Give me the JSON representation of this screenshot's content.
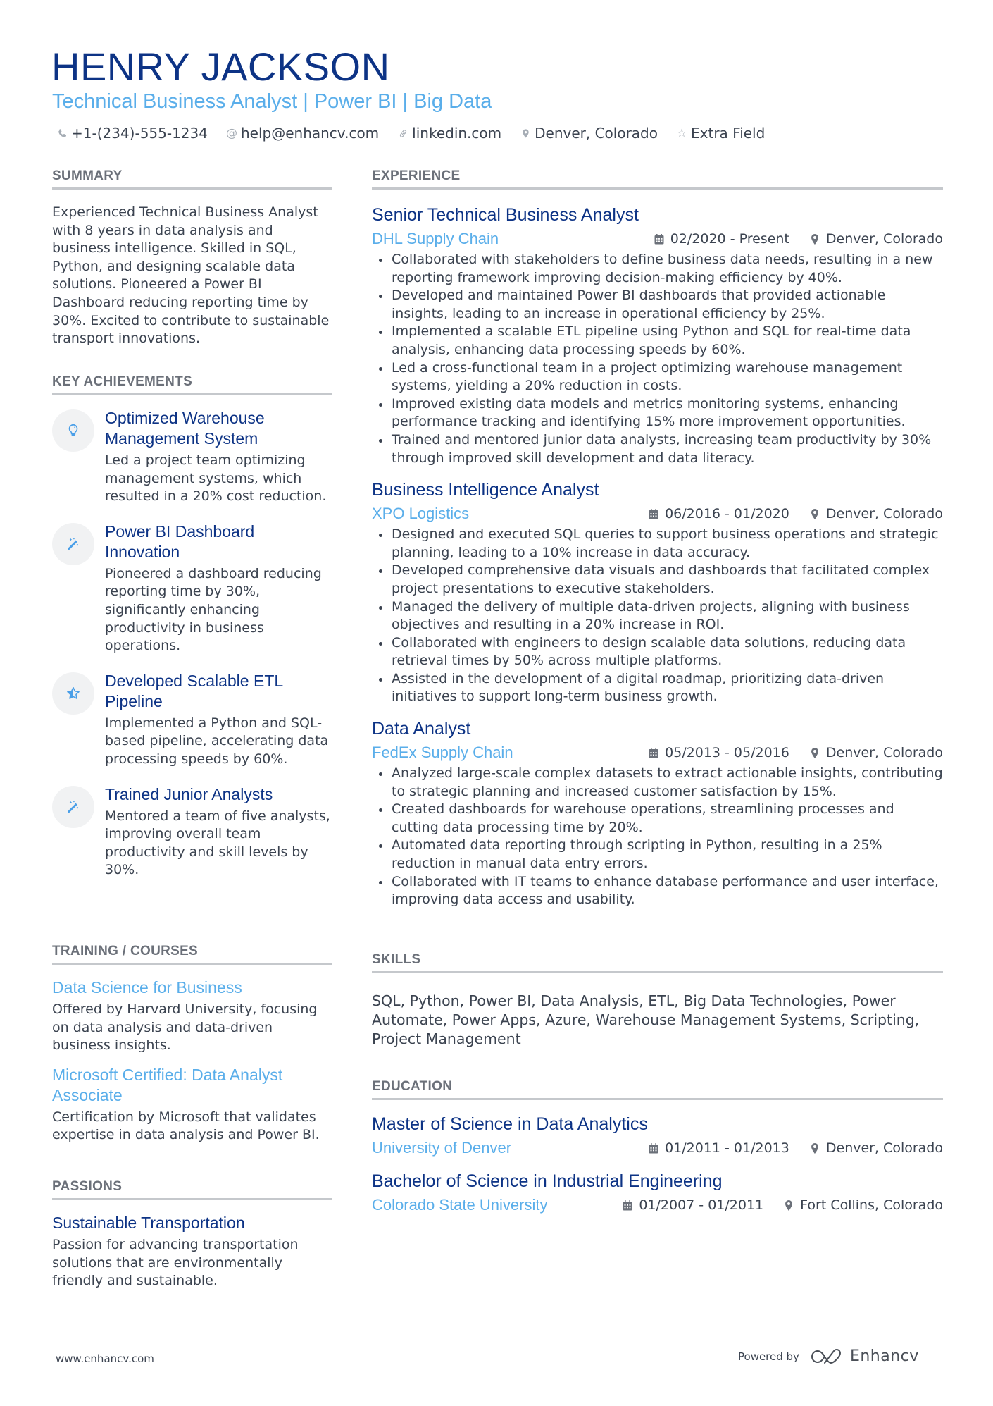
{
  "header": {
    "name": "HENRY JACKSON",
    "headline": "Technical Business Analyst | Power BI | Big Data",
    "contacts": [
      {
        "icon": "phone-icon",
        "text": "+1-(234)-555-1234"
      },
      {
        "icon": "at-icon",
        "text": "help@enhancv.com"
      },
      {
        "icon": "link-icon",
        "text": "linkedin.com"
      },
      {
        "icon": "location-pin-icon",
        "text": "Denver, Colorado"
      },
      {
        "icon": "star-outline-icon",
        "text": "Extra Field"
      }
    ]
  },
  "summary": {
    "title": "SUMMARY",
    "text": "Experienced Technical Business Analyst with 8 years in data analysis and business intelligence. Skilled in SQL, Python, and designing scalable data solutions. Pioneered a Power BI Dashboard reducing reporting time by 30%. Excited to contribute to sustainable transport innovations."
  },
  "achievements": {
    "title": "KEY ACHIEVEMENTS",
    "items": [
      {
        "icon": "lightbulb-icon",
        "title": "Optimized Warehouse Management System",
        "description": "Led a project team optimizing management systems, which resulted in a 20% cost reduction."
      },
      {
        "icon": "magic-wand-icon",
        "title": "Power BI Dashboard Innovation",
        "description": "Pioneered a dashboard reducing reporting time by 30%, significantly enhancing productivity in business operations."
      },
      {
        "icon": "star-half-icon",
        "title": "Developed Scalable ETL Pipeline",
        "description": "Implemented a Python and SQL-based pipeline, accelerating data processing speeds by 60%."
      },
      {
        "icon": "magic-wand-icon",
        "title": "Trained Junior Analysts",
        "description": "Mentored a team of five analysts, improving overall team productivity and skill levels by 30%."
      }
    ]
  },
  "training": {
    "title": "TRAINING / COURSES",
    "items": [
      {
        "title": "Data Science for Business",
        "description": "Offered by Harvard University, focusing on data analysis and data-driven business insights."
      },
      {
        "title": "Microsoft Certified: Data Analyst Associate",
        "description": "Certification by Microsoft that validates expertise in data analysis and Power BI."
      }
    ]
  },
  "passions": {
    "title": "PASSIONS",
    "items": [
      {
        "title": "Sustainable Transportation",
        "description": "Passion for advancing transportation solutions that are environmentally friendly and sustainable."
      }
    ]
  },
  "experience": {
    "title": "EXPERIENCE",
    "jobs": [
      {
        "title": "Senior Technical Business Analyst",
        "company": "DHL Supply Chain",
        "dates": "02/2020 - Present",
        "location": "Denver, Colorado",
        "bullets": [
          "Collaborated with stakeholders to define business data needs, resulting in a new reporting framework improving decision-making efficiency by 40%.",
          "Developed and maintained Power BI dashboards that provided actionable insights, leading to an increase in operational efficiency by 25%.",
          "Implemented a scalable ETL pipeline using Python and SQL for real-time data analysis, enhancing data processing speeds by 60%.",
          "Led a cross-functional team in a project optimizing warehouse management systems, yielding a 20% reduction in costs.",
          "Improved existing data models and metrics monitoring systems, enhancing performance tracking and identifying 15% more improvement opportunities.",
          "Trained and mentored junior data analysts, increasing team productivity by 30% through improved skill development and data literacy."
        ]
      },
      {
        "title": "Business Intelligence Analyst",
        "company": "XPO Logistics",
        "dates": "06/2016 - 01/2020",
        "location": "Denver, Colorado",
        "bullets": [
          "Designed and executed SQL queries to support business operations and strategic planning, leading to a 10% increase in data accuracy.",
          "Developed comprehensive data visuals and dashboards that facilitated complex project presentations to executive stakeholders.",
          "Managed the delivery of multiple data-driven projects, aligning with business objectives and resulting in a 20% increase in ROI.",
          "Collaborated with engineers to design scalable data solutions, reducing data retrieval times by 50% across multiple platforms.",
          "Assisted in the development of a digital roadmap, prioritizing data-driven initiatives to support long-term business growth."
        ]
      },
      {
        "title": "Data Analyst",
        "company": "FedEx Supply Chain",
        "dates": "05/2013 - 05/2016",
        "location": "Denver, Colorado",
        "bullets": [
          "Analyzed large-scale complex datasets to extract actionable insights, contributing to strategic planning and increased customer satisfaction by 15%.",
          "Created dashboards for warehouse operations, streamlining processes and cutting data processing time by 20%.",
          "Automated data reporting through scripting in Python, resulting in a 25% reduction in manual data entry errors.",
          "Collaborated with IT teams to enhance database performance and user interface, improving data access and usability."
        ]
      }
    ]
  },
  "skills": {
    "title": "SKILLS",
    "text": "SQL, Python, Power BI, Data Analysis, ETL, Big Data Technologies, Power Automate, Power Apps, Azure, Warehouse Management Systems, Scripting, Project Management"
  },
  "education": {
    "title": "EDUCATION",
    "items": [
      {
        "degree": "Master of Science in Data Analytics",
        "school": "University of Denver",
        "dates": "01/2011 - 01/2013",
        "location": "Denver, Colorado"
      },
      {
        "degree": "Bachelor of Science in Industrial Engineering",
        "school": "Colorado State University",
        "dates": "01/2007 - 01/2011",
        "location": "Fort Collins, Colorado"
      }
    ]
  },
  "footer": {
    "website": "www.enhancv.com",
    "powered_by": "Powered by",
    "brand": "Enhancv"
  },
  "colors": {
    "primary": "#0d3385",
    "accent": "#5aaeea",
    "text": "#3b4350",
    "muted": "#6b7079",
    "rule": "#c5c8cc",
    "icon_bg": "#f1f2f3"
  }
}
